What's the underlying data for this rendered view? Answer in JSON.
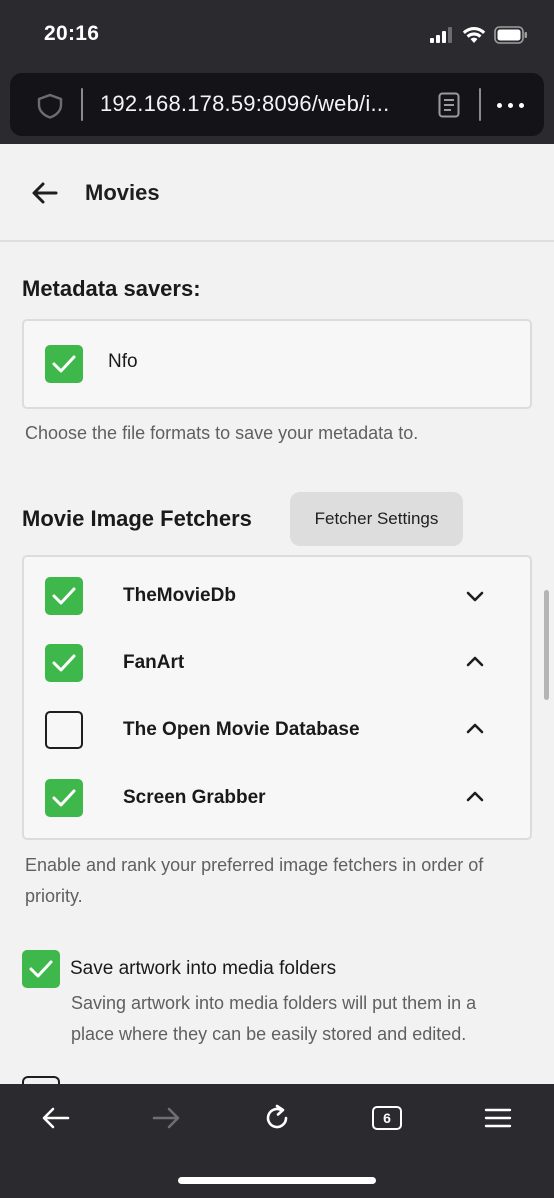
{
  "status_bar": {
    "time": "20:16"
  },
  "browser": {
    "url": "192.168.178.59:8096/web/i..."
  },
  "header": {
    "title": "Movies"
  },
  "metadata_savers": {
    "title": "Metadata savers:",
    "items": [
      {
        "label": "Nfo",
        "checked": true
      }
    ],
    "help": "Choose the file formats to save your metadata to."
  },
  "image_fetchers": {
    "title": "Movie Image Fetchers",
    "settings_button": "Fetcher Settings",
    "items": [
      {
        "label": "TheMovieDb",
        "checked": true,
        "arrow": "down"
      },
      {
        "label": "FanArt",
        "checked": true,
        "arrow": "up"
      },
      {
        "label": "The Open Movie Database",
        "checked": false,
        "arrow": "up"
      },
      {
        "label": "Screen Grabber",
        "checked": true,
        "arrow": "up"
      }
    ],
    "help_line1": "Enable and rank your preferred image fetchers in order of",
    "help_line2": "priority."
  },
  "save_artwork": {
    "label": "Save artwork into media folders",
    "checked": true,
    "help_line1": "Saving artwork into media folders will put them in a",
    "help_line2": "place where they can be easily stored and edited."
  },
  "toolbar": {
    "tabs_count": "6"
  },
  "colors": {
    "accent_green": "#3fb84b",
    "chrome_dark": "#2a2a2f"
  }
}
